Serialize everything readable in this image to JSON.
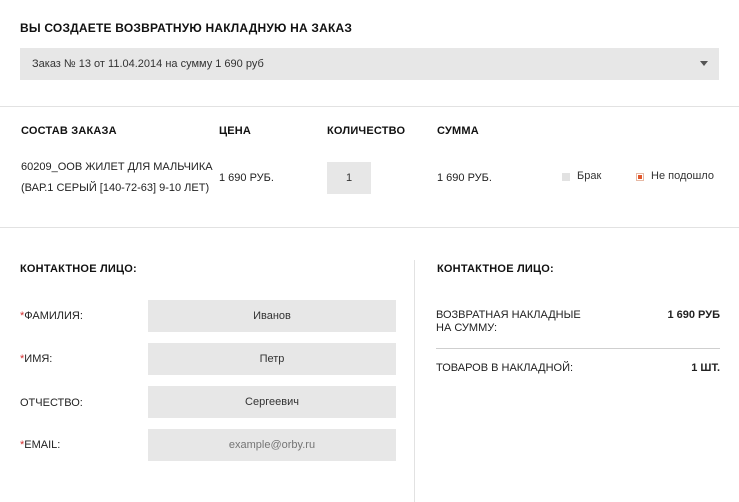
{
  "page": {
    "title": "ВЫ СОЗДАЕТЕ ВОЗВРАТНУЮ НАКЛАДНУЮ НА ЗАКАЗ"
  },
  "order_select": {
    "selected": "Заказ № 13 от 11.04.2014 на сумму 1 690 руб"
  },
  "order_table": {
    "headers": {
      "composition": "СОСТАВ ЗАКАЗА",
      "price": "ЦЕНА",
      "quantity": "КОЛИЧЕСТВО",
      "sum": "СУММА"
    },
    "rows": [
      {
        "name_line1": "60209_OOB ЖИЛЕТ ДЛЯ МАЛЬЧИКА",
        "name_line2": "(ВАР.1 СЕРЫЙ [140-72-63] 9-10 ЛЕТ)",
        "price": "1 690 РУБ.",
        "quantity": "1",
        "sum": "1 690 РУБ.",
        "reason_defect": "Брак",
        "reason_not_fit": "Не подошло",
        "selected_reason": "Не подошло"
      }
    ]
  },
  "contact": {
    "heading": "КОНТАКТНОЕ ЛИЦО:",
    "required_mark": "*",
    "fields": {
      "surname": {
        "label": "ФАМИЛИЯ:",
        "value": "Иванов"
      },
      "name": {
        "label": "ИМЯ:",
        "value": "Петр"
      },
      "patronymic": {
        "label": "ОТЧЕСТВО:",
        "value": "Сергеевич"
      },
      "email": {
        "label": "EMAIL:",
        "value": "",
        "placeholder": "example@orby.ru"
      }
    }
  },
  "summary": {
    "heading": "КОНТАКТНОЕ ЛИЦО:",
    "total_label_line1": "ВОЗВРАТНАЯ НАКЛАДНЫЕ",
    "total_label_line2": "НА СУММУ:",
    "total_value": "1 690 РУБ",
    "items_label": "ТОВАРОВ В НАКЛАДНОЙ:",
    "items_value": "1 ШТ."
  },
  "colors": {
    "accent": "#e2572b",
    "required": "#d32f2f",
    "field_bg": "#e7e7e7",
    "divider": "#e2e2e2"
  }
}
